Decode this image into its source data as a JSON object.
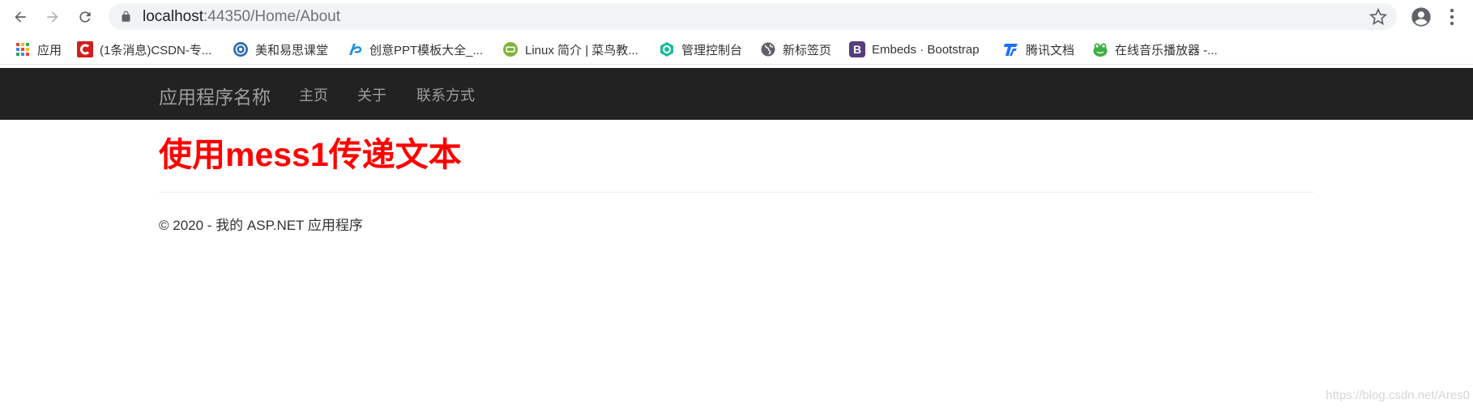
{
  "browser": {
    "url_host": "localhost",
    "url_rest": ":44350/Home/About",
    "icons": [
      "back-icon",
      "forward-icon",
      "reload-icon",
      "lock-icon",
      "star-icon",
      "profile-icon",
      "menu-icon"
    ]
  },
  "bookmarks": [
    {
      "label": "应用",
      "icon": "apps-grid-icon"
    },
    {
      "label": "(1条消息)CSDN-专...",
      "icon": "csdn-icon",
      "color": "#d01e1e"
    },
    {
      "label": "美和易思课堂",
      "icon": "globe-badge-icon",
      "color": "#2e6db5"
    },
    {
      "label": "创意PPT模板大全_...",
      "icon": "ppt-icon",
      "color": "#1d8fe0"
    },
    {
      "label": "Linux 简介 | 菜鸟教...",
      "icon": "runoob-icon",
      "color": "#7fb53a"
    },
    {
      "label": "管理控制台",
      "icon": "console-icon",
      "color": "#1bbc9b"
    },
    {
      "label": "新标签页",
      "icon": "globe-icon",
      "color": "#5f6368"
    },
    {
      "label": "Embeds · Bootstrap",
      "icon": "bootstrap-icon",
      "color": "#563d7c"
    },
    {
      "label": "腾讯文档",
      "icon": "tencent-docs-icon",
      "color": "#1e6fff"
    },
    {
      "label": "在线音乐播放器 -...",
      "icon": "frog-icon",
      "color": "#3cb043"
    }
  ],
  "site": {
    "brand": "应用程序名称",
    "nav": [
      "主页",
      "关于",
      "联系方式"
    ],
    "heading": "使用mess1传递文本",
    "footer": "© 2020 - 我的 ASP.NET 应用程序",
    "watermark": "https://blog.csdn.net/Ares0",
    "colors": {
      "navbar": "#222222",
      "nav_text": "#9d9d9d",
      "heading": "#ff0000"
    }
  }
}
